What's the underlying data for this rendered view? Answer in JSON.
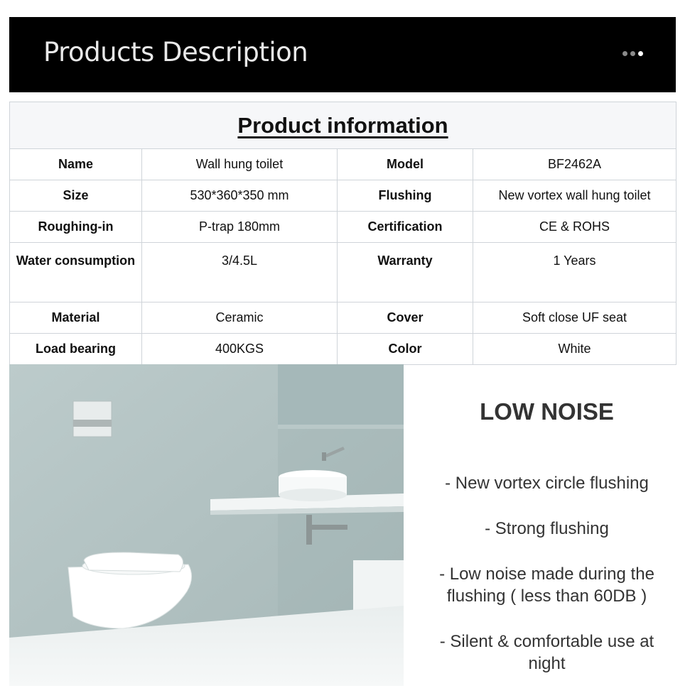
{
  "banner": {
    "title": "Products Description",
    "dots": 3,
    "active_dot": 2
  },
  "table": {
    "title": "Product information",
    "rows": [
      {
        "k1": "Name",
        "v1": "Wall hung toilet",
        "k2": "Model",
        "v2": "BF2462A"
      },
      {
        "k1": "Size",
        "v1": "530*360*350 mm",
        "k2": "Flushing",
        "v2": "New vortex wall hung toilet"
      },
      {
        "k1": "Roughing-in",
        "v1": "P-trap 180mm",
        "k2": "Certification",
        "v2": "CE & ROHS"
      },
      {
        "k1": "Water consumption",
        "v1": "3/4.5L",
        "k2": "Warranty",
        "v2": "1 Years"
      },
      {
        "k1": "Material",
        "v1": "Ceramic",
        "k2": "Cover",
        "v2": "Soft close UF seat"
      },
      {
        "k1": "Load bearing",
        "v1": "400KGS",
        "k2": "Color",
        "v2": "White"
      }
    ]
  },
  "feature": {
    "title": "LOW NOISE",
    "points": [
      "- New vortex circle flushing",
      "- Strong flushing",
      "- Low noise made during the flushing ( less than 60DB )",
      "- Silent & comfortable use at night"
    ]
  },
  "colors": {
    "banner_bg": "#000000",
    "wall": "#b7c6c6",
    "table_border": "#cfd4d9"
  }
}
